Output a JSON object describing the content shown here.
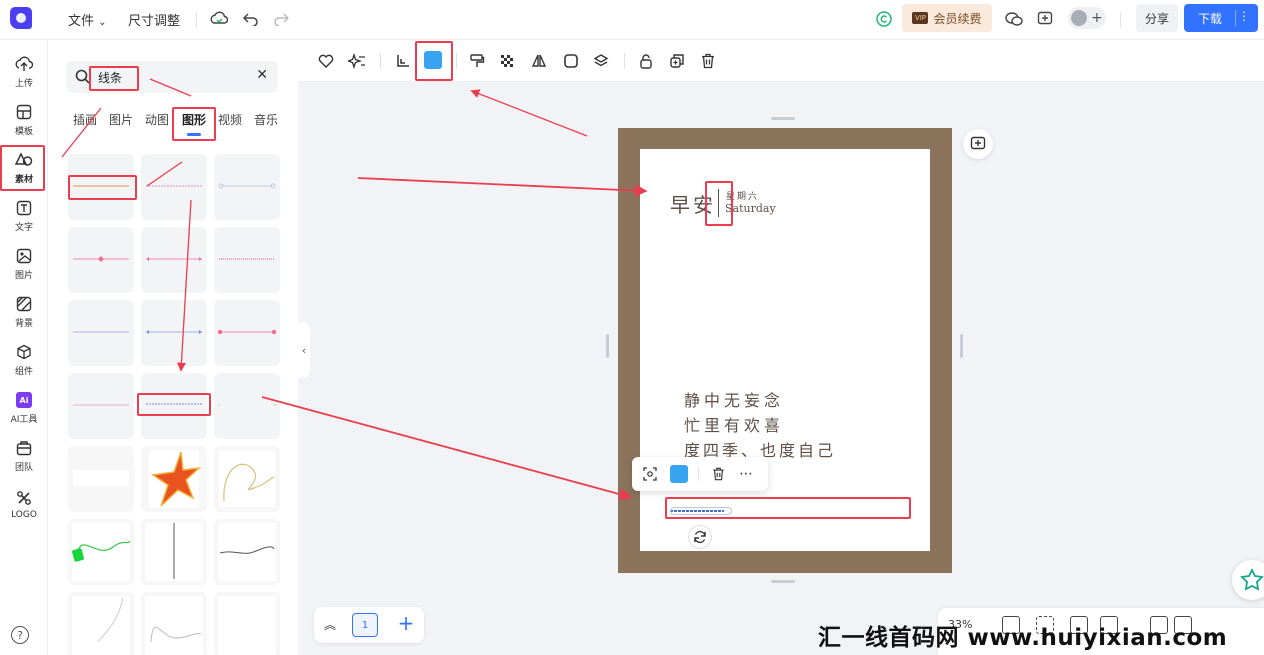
{
  "topbar": {
    "menu_file": "文件",
    "menu_resize": "尺寸调整",
    "vip_label": "会员续费",
    "vip_badge": "VIP",
    "share_label": "分享",
    "download_label": "下载"
  },
  "rail": {
    "items": [
      {
        "label": "上传",
        "icon": "upload-icon"
      },
      {
        "label": "模板",
        "icon": "template-icon"
      },
      {
        "label": "素材",
        "icon": "material-icon"
      },
      {
        "label": "文字",
        "icon": "text-icon"
      },
      {
        "label": "图片",
        "icon": "image-icon"
      },
      {
        "label": "背景",
        "icon": "background-icon"
      },
      {
        "label": "组件",
        "icon": "component-icon"
      },
      {
        "label": "AI工具",
        "icon": "ai-icon"
      },
      {
        "label": "团队",
        "icon": "team-icon"
      },
      {
        "label": "LOGO",
        "icon": "logo-icon"
      }
    ],
    "ai_glyph": "Ai"
  },
  "panel": {
    "search_value": "线条",
    "tabs": [
      "插画",
      "图片",
      "动图",
      "图形",
      "视频",
      "音乐"
    ],
    "active_tab": "图形"
  },
  "design": {
    "greeting": "早安",
    "weekday_cn": "星期六",
    "weekday_en": "Saturday",
    "poem": [
      "静中无妄念",
      "忙里有欢喜",
      "度四季、也度自己"
    ]
  },
  "pager": {
    "current_page": "1"
  },
  "zoom": {
    "level": "33%"
  },
  "watermark": "汇一线首码网 www.huiyixian.com",
  "colors": {
    "accent": "#3173ff",
    "selected_fill": "#39a4f2",
    "frame_brown": "#8b735c",
    "annotation_red": "#ea3e4f"
  }
}
